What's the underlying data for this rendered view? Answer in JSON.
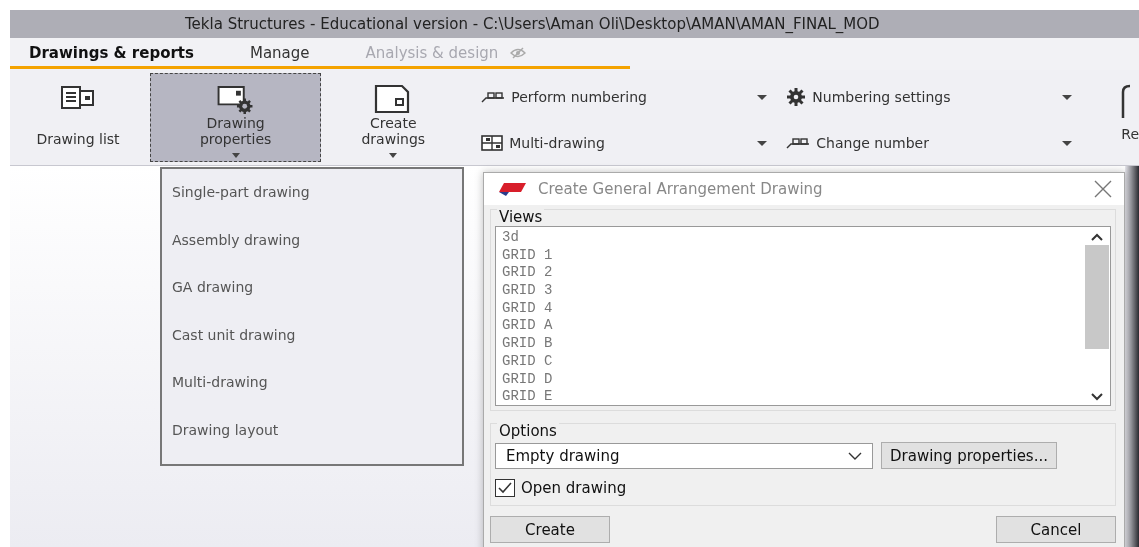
{
  "window": {
    "title": "Tekla Structures - Educational version - C:\\Users\\Aman Oli\\Desktop\\AMAN\\AMAN_FINAL_MOD"
  },
  "tabs": [
    {
      "label": "Drawings & reports",
      "selected": true,
      "disabled": false
    },
    {
      "label": "Manage",
      "selected": false,
      "disabled": false
    },
    {
      "label": "Analysis & design",
      "selected": false,
      "disabled": true
    }
  ],
  "ribbon": {
    "large_buttons": [
      {
        "label": "Drawing list",
        "kind": "list",
        "pressed": false,
        "dropdown": false
      },
      {
        "label": "Drawing properties",
        "kind": "properties",
        "pressed": true,
        "dropdown": true
      },
      {
        "label": "Create drawings",
        "kind": "create",
        "pressed": false,
        "dropdown": true
      }
    ],
    "small_buttons": [
      {
        "label": "Perform numbering",
        "kind": "numbering"
      },
      {
        "label": "Numbering settings",
        "kind": "settings"
      },
      {
        "label": "Multi-drawing",
        "kind": "multi"
      },
      {
        "label": "Change number",
        "kind": "numbering"
      }
    ],
    "cut_button": {
      "label": "Re"
    }
  },
  "dropdown_menu": {
    "items": [
      "Single-part drawing",
      "Assembly drawing",
      "GA drawing",
      "Cast unit drawing",
      "Multi-drawing",
      "Drawing layout"
    ]
  },
  "dialog": {
    "title": "Create General Arrangement Drawing",
    "views": {
      "label": "Views",
      "items": [
        "3d",
        "GRID 1",
        "GRID 2",
        "GRID 3",
        "GRID 4",
        "GRID A",
        "GRID B",
        "GRID C",
        "GRID D",
        "GRID E"
      ]
    },
    "options": {
      "label": "Options",
      "drawing_type": "Empty drawing",
      "properties_button": "Drawing properties...",
      "open_drawing": {
        "label": "Open drawing",
        "checked": true
      }
    },
    "buttons": [
      "Create",
      "Cancel"
    ]
  }
}
